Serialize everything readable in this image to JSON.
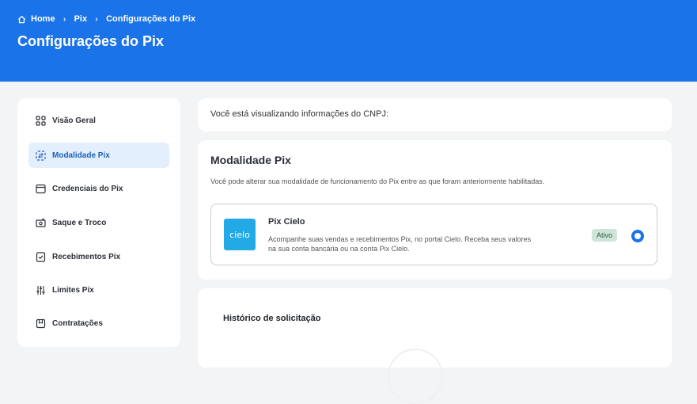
{
  "breadcrumb": {
    "home": "Home",
    "pix": "Pix",
    "current": "Configurações do Pix"
  },
  "page": {
    "title": "Configurações do Pix"
  },
  "sidebar": {
    "items": [
      {
        "label": "Visão Geral",
        "icon": "grid-icon"
      },
      {
        "label": "Modalidade Pix",
        "icon": "swap-icon",
        "active": true
      },
      {
        "label": "Credenciais do Pix",
        "icon": "browser-icon"
      },
      {
        "label": "Saque e Troco",
        "icon": "cash-icon"
      },
      {
        "label": "Recebimentos Pix",
        "icon": "checklist-icon"
      },
      {
        "label": "Limites Pix",
        "icon": "sliders-icon"
      },
      {
        "label": "Contratações",
        "icon": "document-icon"
      }
    ]
  },
  "cnpj": {
    "text": "Você está visualizando informações do CNPJ:"
  },
  "modalidade": {
    "title": "Modalidade Pix",
    "description": "Você pode alterar sua modalidade de funcionamento do Pix entre as que foram anteriormente habilitadas.",
    "option": {
      "logo_text": "cielo",
      "title": "Pix Cielo",
      "description": "Acompanhe suas vendas e recebimentos Pix, no portal Cielo. Receba seus valores na sua conta bancária ou na conta Pix Cielo.",
      "status": "Ativo"
    }
  },
  "historico": {
    "title": "Histórico de solicitação"
  },
  "colors": {
    "header": "#1a73e8",
    "accent": "#1a73e8",
    "active_bg": "#e3effd",
    "badge_bg": "#cfe4d9"
  }
}
